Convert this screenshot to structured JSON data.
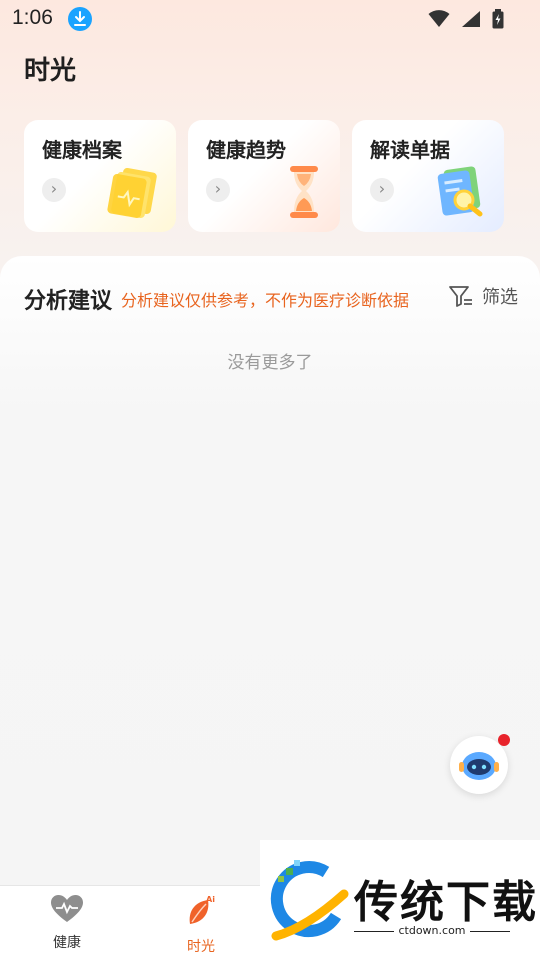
{
  "status_bar": {
    "time": "1:06"
  },
  "header": {
    "title": "时光"
  },
  "cards": [
    {
      "label": "健康档案",
      "icon": "health-record-icon"
    },
    {
      "label": "健康趋势",
      "icon": "hourglass-icon"
    },
    {
      "label": "解读单据",
      "icon": "document-search-icon"
    }
  ],
  "analysis": {
    "title": "分析建议",
    "note": "分析建议仅供参考，不作为医疗诊断依据",
    "filter_label": "筛选",
    "empty_text": "没有更多了"
  },
  "tabbar": {
    "tabs": [
      {
        "label": "健康",
        "icon": "heart-pulse-icon",
        "active": false
      },
      {
        "label": "时光",
        "icon": "leaf-ai-icon",
        "active": true
      }
    ]
  },
  "watermark": {
    "text": "传统下载",
    "url": "ctdown.com"
  },
  "colors": {
    "accent": "#e8641f",
    "notification_dot": "#e8232b",
    "download_badge": "#1aa3ff"
  }
}
